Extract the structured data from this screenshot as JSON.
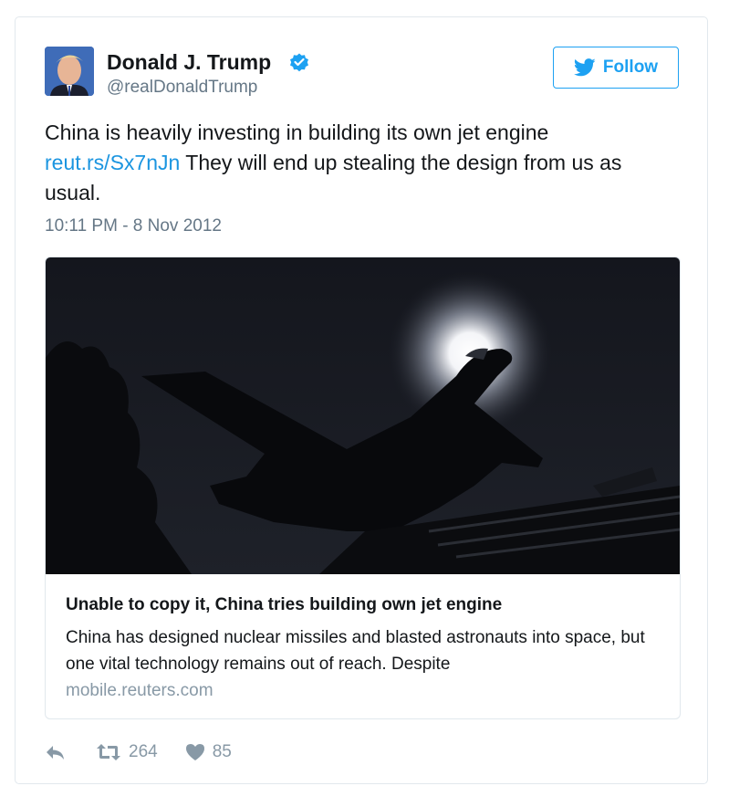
{
  "tweet": {
    "author_name": "Donald J. Trump",
    "author_handle": "@realDonaldTrump",
    "follow_label": "Follow",
    "text_part1": "China is heavily investing in building its own jet engine ",
    "link_text": "reut.rs/Sx7nJn",
    "text_part2": " They will end up stealing the design from us as usual.",
    "timestamp": "10:11 PM - 8 Nov 2012"
  },
  "card": {
    "title": "Unable to copy it, China tries building own jet engine",
    "description": "China has designed nuclear missiles and blasted astronauts into space, but one vital technology remains out of reach. Despite",
    "domain": "mobile.reuters.com"
  },
  "actions": {
    "retweet_count": "264",
    "like_count": "85"
  },
  "colors": {
    "accent": "#1da1f2",
    "link": "#1b95e0",
    "muted": "#657786",
    "border": "#e1e8ed"
  },
  "icons": [
    "verified-badge-icon",
    "twitter-bird-icon",
    "reply-icon",
    "retweet-icon",
    "heart-icon"
  ]
}
